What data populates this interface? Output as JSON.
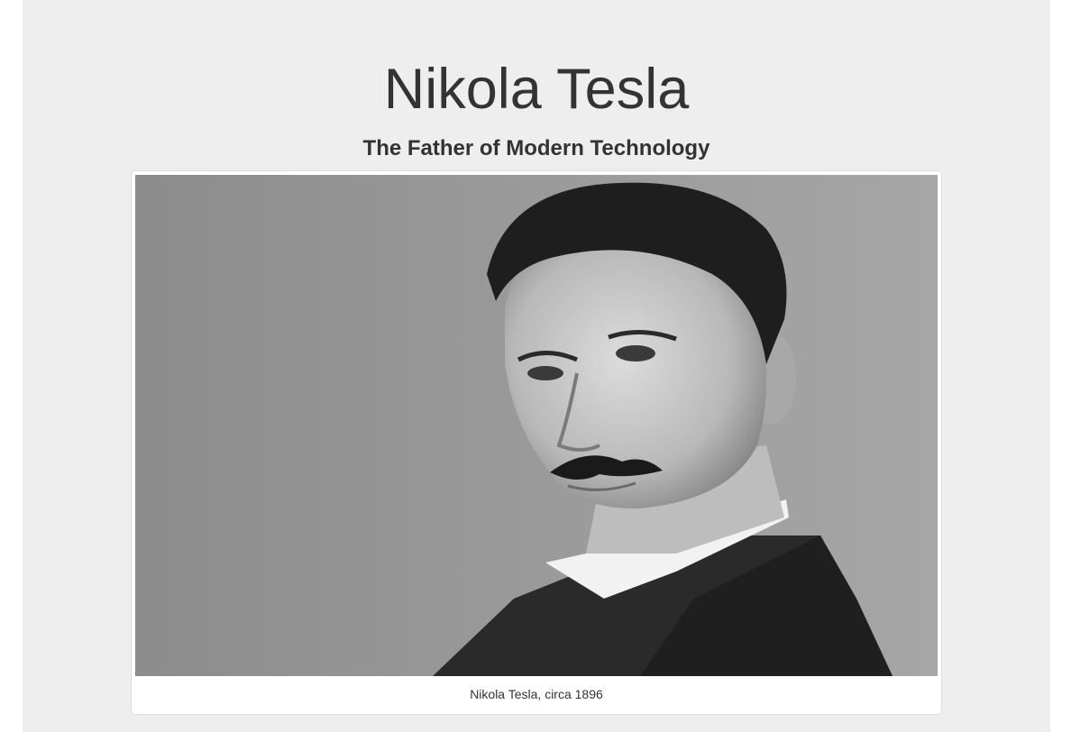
{
  "header": {
    "title": "Nikola Tesla",
    "subtitle": "The Father of Modern Technology"
  },
  "figure": {
    "image_subject": "portrait of Nikola Tesla",
    "caption": "Nikola Tesla, circa 1896"
  },
  "colors": {
    "page_background": "#ffffff",
    "jumbotron_background": "#eeeeee",
    "text": "#333333",
    "thumbnail_border": "#dddddd"
  }
}
